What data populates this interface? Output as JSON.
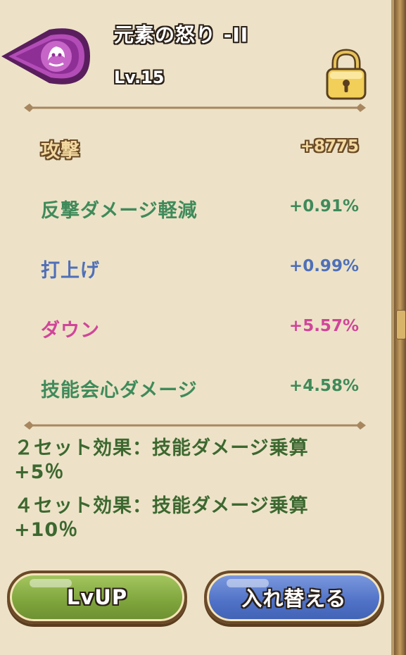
{
  "header": {
    "title": "元素の怒り -II",
    "level": "Lv.15",
    "emblem_icon": "purple-crest-icon",
    "lock_icon": "padlock-icon"
  },
  "stats": {
    "main": {
      "name": "攻撃",
      "value": "+8775",
      "color": "#f3d9a0"
    },
    "sub": [
      {
        "name": "反撃ダメージ軽減",
        "value": "+0.91%",
        "color": "#3f8a5a"
      },
      {
        "name": "打上げ",
        "value": "+0.99%",
        "color": "#4f6fb8"
      },
      {
        "name": "ダウン",
        "value": "+5.57%",
        "color": "#d0459a"
      },
      {
        "name": "技能会心ダメージ",
        "value": "+4.58%",
        "color": "#3f8a5a"
      }
    ]
  },
  "set_effects": {
    "two_set": {
      "line1": "２セット効果：技能ダメージ乗算",
      "line2": "+5％"
    },
    "four_set": {
      "line1": "４セット効果：技能ダメージ乗算",
      "line2": "+10％"
    }
  },
  "buttons": {
    "lvup_label": "LvUP",
    "swap_label": "入れ替える"
  },
  "colors": {
    "panel_bg": "#ede2c7",
    "set_text": "#3c6830",
    "lvup_button": "#7ea43c",
    "swap_button": "#4f71c6",
    "emblem": "#a13ca8"
  }
}
